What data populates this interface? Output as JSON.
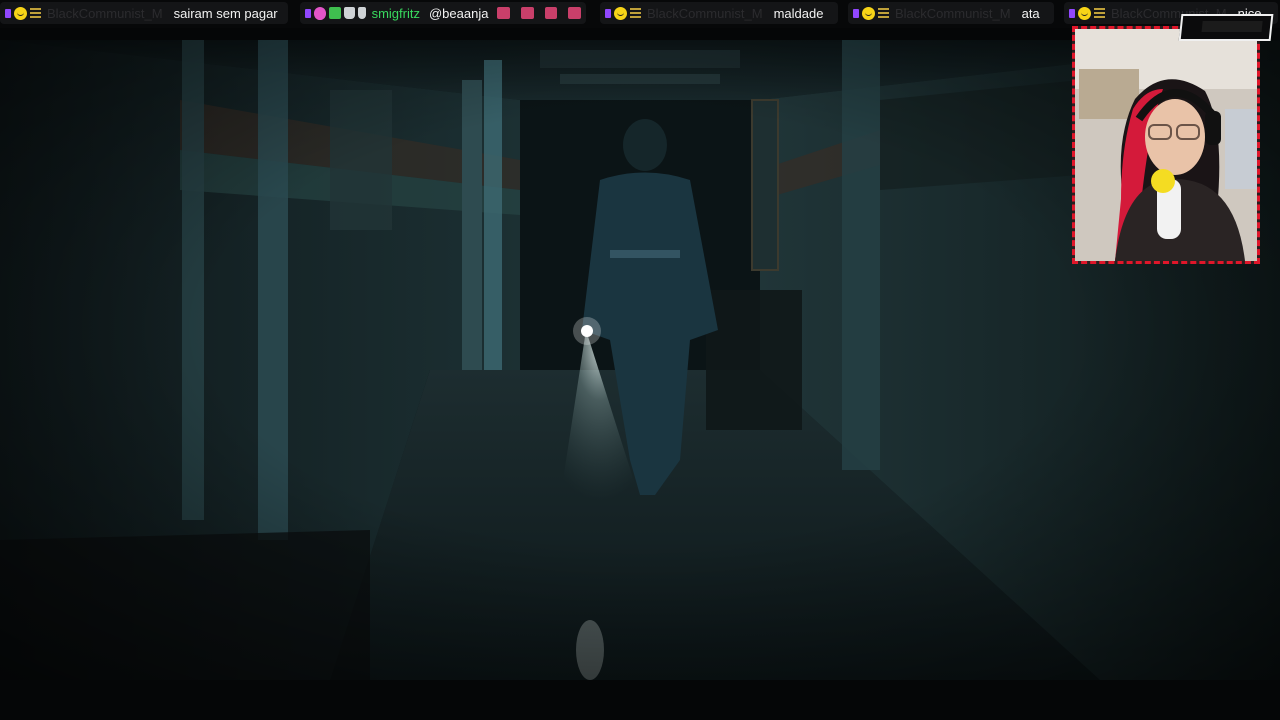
{
  "ticker": {
    "messages": [
      {
        "user": "BlackCommunist_M",
        "user_color": "#2b2b2e",
        "text": "sairam sem pagar",
        "badges": [
          "twitch-badge-icon",
          "smiley-badge-icon",
          "bars-badge-icon"
        ]
      },
      {
        "user": "smigfritz",
        "user_color": "#38d95e",
        "text": "@beaanja",
        "badges": [
          "twitch-badge-icon",
          "pink-badge-icon",
          "green-badge-icon",
          "ghost-badge-icon",
          "bunny-badge-icon"
        ],
        "emotes": [
          "emote-icon",
          "emote-icon",
          "emote-icon",
          "emote-icon"
        ]
      },
      {
        "user": "BlackCommunist_M",
        "user_color": "#2b2b2e",
        "text": "maldade",
        "badges": [
          "twitch-badge-icon",
          "smiley-badge-icon",
          "bars-badge-icon"
        ]
      },
      {
        "user": "BlackCommunist_M",
        "user_color": "#2b2b2e",
        "text": "ata",
        "badges": [
          "twitch-badge-icon",
          "smiley-badge-icon",
          "bars-badge-icon"
        ]
      },
      {
        "user": "BlackCommunist_M",
        "user_color": "#2b2b2e",
        "text": "nice",
        "badges": [
          "twitch-badge-icon",
          "smiley-badge-icon",
          "bars-badge-icon"
        ]
      }
    ]
  },
  "colors": {
    "ticker_bg": "#070809",
    "chip_bg": "#141517",
    "cam_border": "#e0162a",
    "twitch_purple": "#9147ff"
  }
}
